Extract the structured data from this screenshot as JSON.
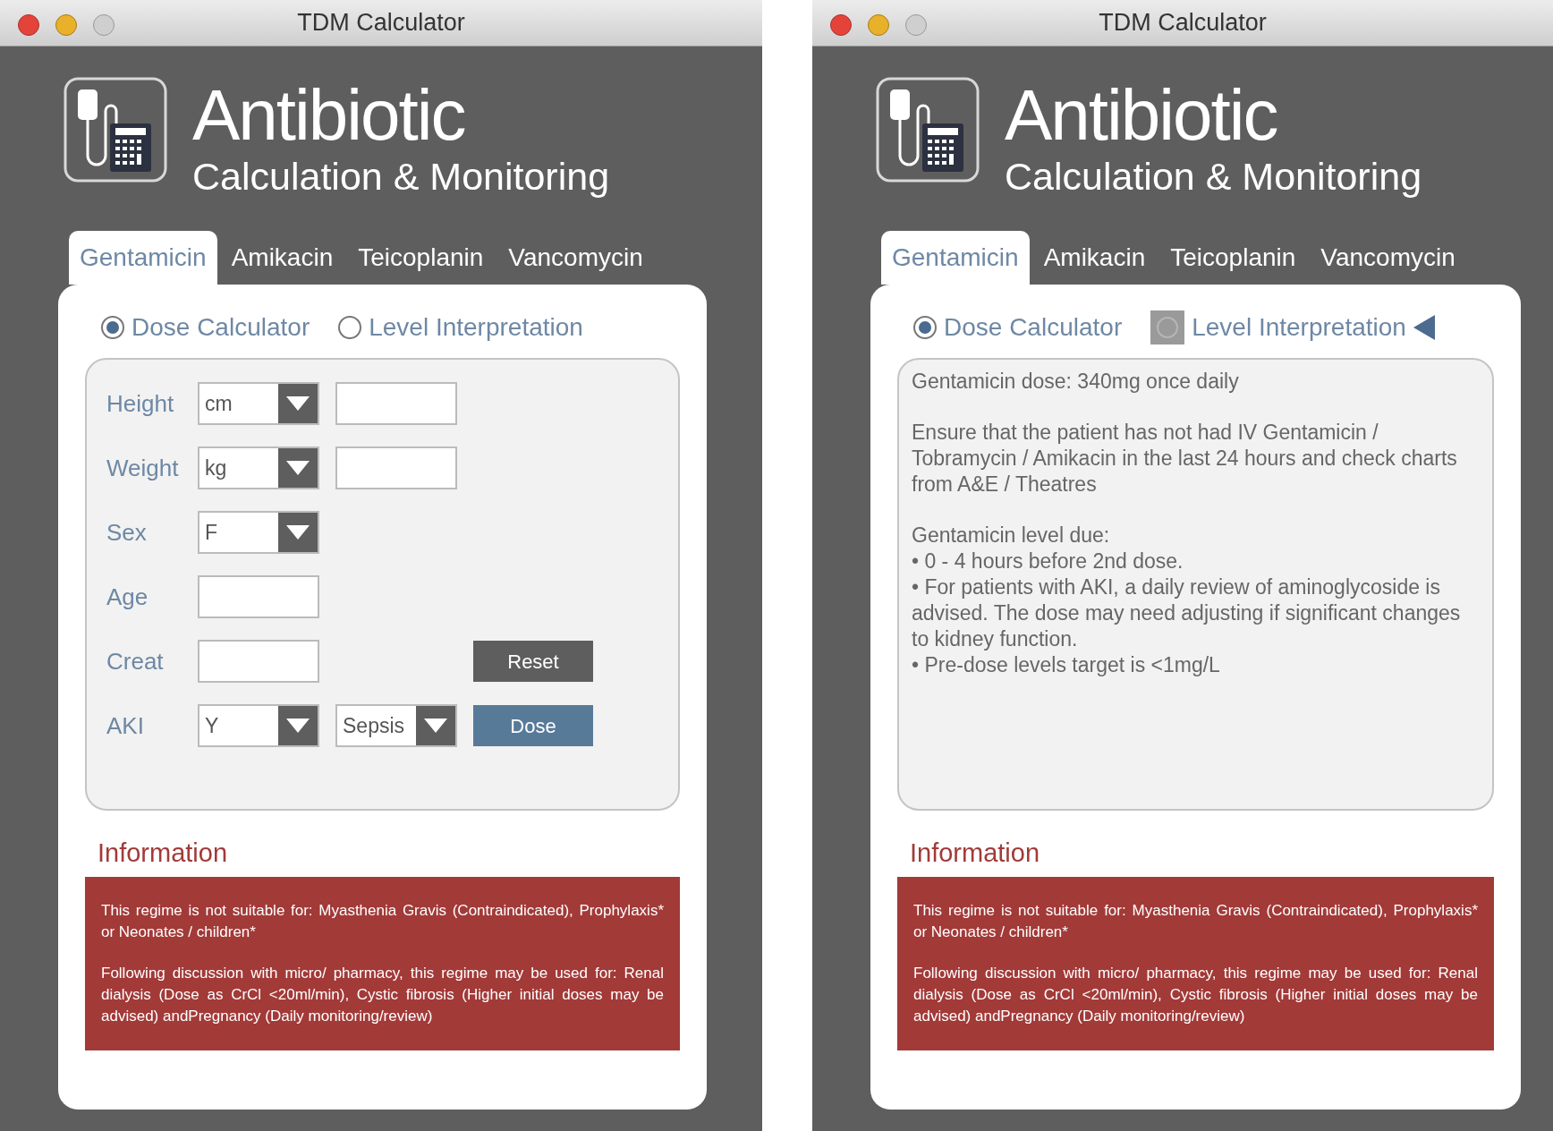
{
  "windows": [
    {
      "title": "TDM Calculator",
      "header": {
        "title": "Antibiotic",
        "subtitle": "Calculation & Monitoring"
      },
      "tabs": [
        {
          "label": "Gentamicin",
          "selected": true
        },
        {
          "label": "Amikacin",
          "selected": false
        },
        {
          "label": "Teicoplanin",
          "selected": false
        },
        {
          "label": "Vancomycin",
          "selected": false
        }
      ],
      "modes": [
        {
          "label": "Dose Calculator",
          "selected": true,
          "disabled": false,
          "pointer": false
        },
        {
          "label": "Level Interpretation",
          "selected": false,
          "disabled": false,
          "pointer": false
        }
      ],
      "view": {
        "kind": "form",
        "rows": [
          {
            "label": "Height",
            "controls": [
              {
                "kind": "select",
                "value": "cm"
              },
              {
                "kind": "input"
              }
            ]
          },
          {
            "label": "Weight",
            "controls": [
              {
                "kind": "select",
                "value": "kg"
              },
              {
                "kind": "input"
              }
            ]
          },
          {
            "label": "Sex",
            "controls": [
              {
                "kind": "select",
                "value": "F"
              }
            ]
          },
          {
            "label": "Age",
            "controls": [
              {
                "kind": "input"
              }
            ]
          },
          {
            "label": "Creat",
            "controls": [
              {
                "kind": "input"
              },
              {
                "kind": "spacer"
              },
              {
                "kind": "button",
                "label": "Reset"
              }
            ]
          },
          {
            "label": "AKI",
            "controls": [
              {
                "kind": "select",
                "value": "Y"
              },
              {
                "kind": "select",
                "value": "Sepsis"
              },
              {
                "kind": "submit",
                "label": "Dose"
              }
            ]
          }
        ]
      },
      "info": {
        "heading": "Information",
        "paragraphs": [
          "This regime is not suitable for: Myasthenia Gravis (Contraindicated), Prophylaxis* or Neonates / children*",
          "Following discussion with micro/ pharmacy, this regime may be used for: Renal dialysis (Dose as CrCl <20ml/min), Cystic fibrosis (Higher initial doses may be advised) andPregnancy (Daily monitoring/review)"
        ]
      }
    },
    {
      "title": "TDM Calculator",
      "header": {
        "title": "Antibiotic",
        "subtitle": "Calculation & Monitoring"
      },
      "tabs": [
        {
          "label": "Gentamicin",
          "selected": true
        },
        {
          "label": "Amikacin",
          "selected": false
        },
        {
          "label": "Teicoplanin",
          "selected": false
        },
        {
          "label": "Vancomycin",
          "selected": false
        }
      ],
      "modes": [
        {
          "label": "Dose Calculator",
          "selected": true,
          "disabled": false,
          "pointer": false
        },
        {
          "label": "Level Interpretation",
          "selected": false,
          "disabled": true,
          "pointer": true
        }
      ],
      "view": {
        "kind": "result",
        "blocks": [
          [
            "Gentamicin dose: 340mg once daily"
          ],
          [
            "Ensure that the patient has not had IV Gentamicin / Tobramycin / Amikacin in the last 24 hours and check charts from A&E / Theatres"
          ],
          [
            "Gentamicin level due:",
            "• 0 - 4 hours before 2nd dose.",
            "• For patients with AKI, a daily review of aminoglycoside is advised. The dose may need adjusting if significant changes to kidney function.",
            "• Pre-dose levels target is <1mg/L"
          ]
        ]
      },
      "info": {
        "heading": "Information",
        "paragraphs": [
          "This regime is not suitable for: Myasthenia Gravis (Contraindicated), Prophylaxis* or Neonates / children*",
          "Following discussion with micro/ pharmacy, this regime may be used for: Renal dialysis (Dose as CrCl <20ml/min), Cystic fibrosis (Higher initial doses may be advised) andPregnancy (Daily monitoring/review)"
        ]
      }
    }
  ]
}
